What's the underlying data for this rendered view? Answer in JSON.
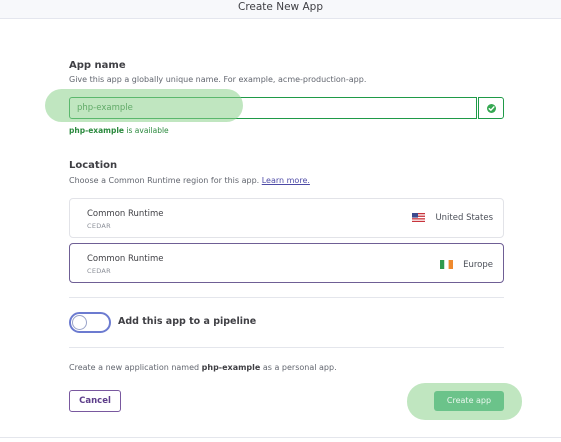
{
  "dialog": {
    "title": "Create New App"
  },
  "app_name": {
    "heading": "App name",
    "description": "Give this app a globally unique name. For example, acme-production-app.",
    "input_value": "php-example",
    "availability_name": "php-example",
    "availability_suffix": "is available",
    "status_icon": "check-circle-icon"
  },
  "location": {
    "heading": "Location",
    "description": "Choose a Common Runtime region for this app.",
    "learn_more_label": "Learn more.",
    "regions": [
      {
        "name": "Common Runtime",
        "code": "CEDAR",
        "location": "United States",
        "flag_icon": "us-flag-icon",
        "selected": false
      },
      {
        "name": "Common Runtime",
        "code": "CEDAR",
        "location": "Europe",
        "flag_icon": "ireland-flag-icon",
        "selected": true
      }
    ]
  },
  "pipeline": {
    "label": "Add this app to a pipeline",
    "enabled": false
  },
  "summary": {
    "prefix": "Create a new application named",
    "app_name": "php-example",
    "suffix": "as a personal app."
  },
  "actions": {
    "cancel_label": "Cancel",
    "create_label": "Create app"
  },
  "colors": {
    "success_green": "#1f9a48",
    "accent_purple": "#79589f",
    "create_button": "#6bc38a",
    "selected_border": "#6f5f95"
  }
}
